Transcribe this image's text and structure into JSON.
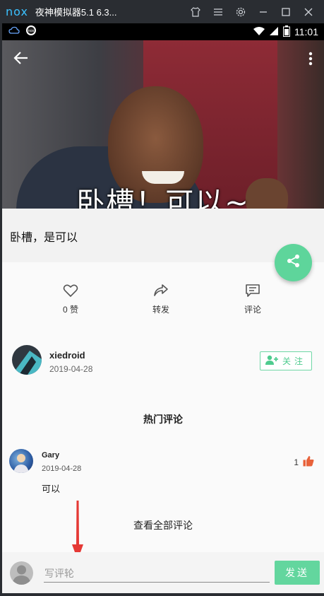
{
  "emulator": {
    "logo": "nox",
    "title": "夜神模拟器5.1 6.3...",
    "controls": [
      "shirt-icon",
      "menu-icon",
      "gear-icon",
      "minimize-icon",
      "maximize-icon",
      "close-icon"
    ]
  },
  "status_bar": {
    "left_icons": [
      "cloud-icon",
      "nox-badge-icon"
    ],
    "right_icons": [
      "wifi-icon",
      "signal-icon",
      "battery-icon"
    ],
    "time": "11:01"
  },
  "hero": {
    "caption": "卧槽！可以~",
    "back_icon": "back-arrow-icon",
    "more_icon": "more-vert-icon"
  },
  "post": {
    "title": "卧槽，是可以"
  },
  "share": {
    "icon": "share-icon",
    "color": "#5ed59b"
  },
  "actions": {
    "like": {
      "icon": "heart-icon",
      "label": "0 赞"
    },
    "forward": {
      "icon": "forward-icon",
      "label": "转发"
    },
    "comment": {
      "icon": "comment-icon",
      "label": "评论"
    }
  },
  "author": {
    "name": "xiedroid",
    "date": "2019-04-28",
    "follow_label": "关注",
    "follow_icon": "add-user-icon"
  },
  "comments": {
    "heading": "热门评论",
    "items": [
      {
        "user": "Gary",
        "date": "2019-04-28",
        "text": "可以",
        "likes": "1"
      }
    ],
    "view_all": "查看全部评论"
  },
  "composer": {
    "placeholder": "写评轮",
    "send_label": "发送"
  },
  "colors": {
    "accent": "#5ed59b",
    "like": "#e8623a",
    "annotation_arrow": "#e53935"
  }
}
